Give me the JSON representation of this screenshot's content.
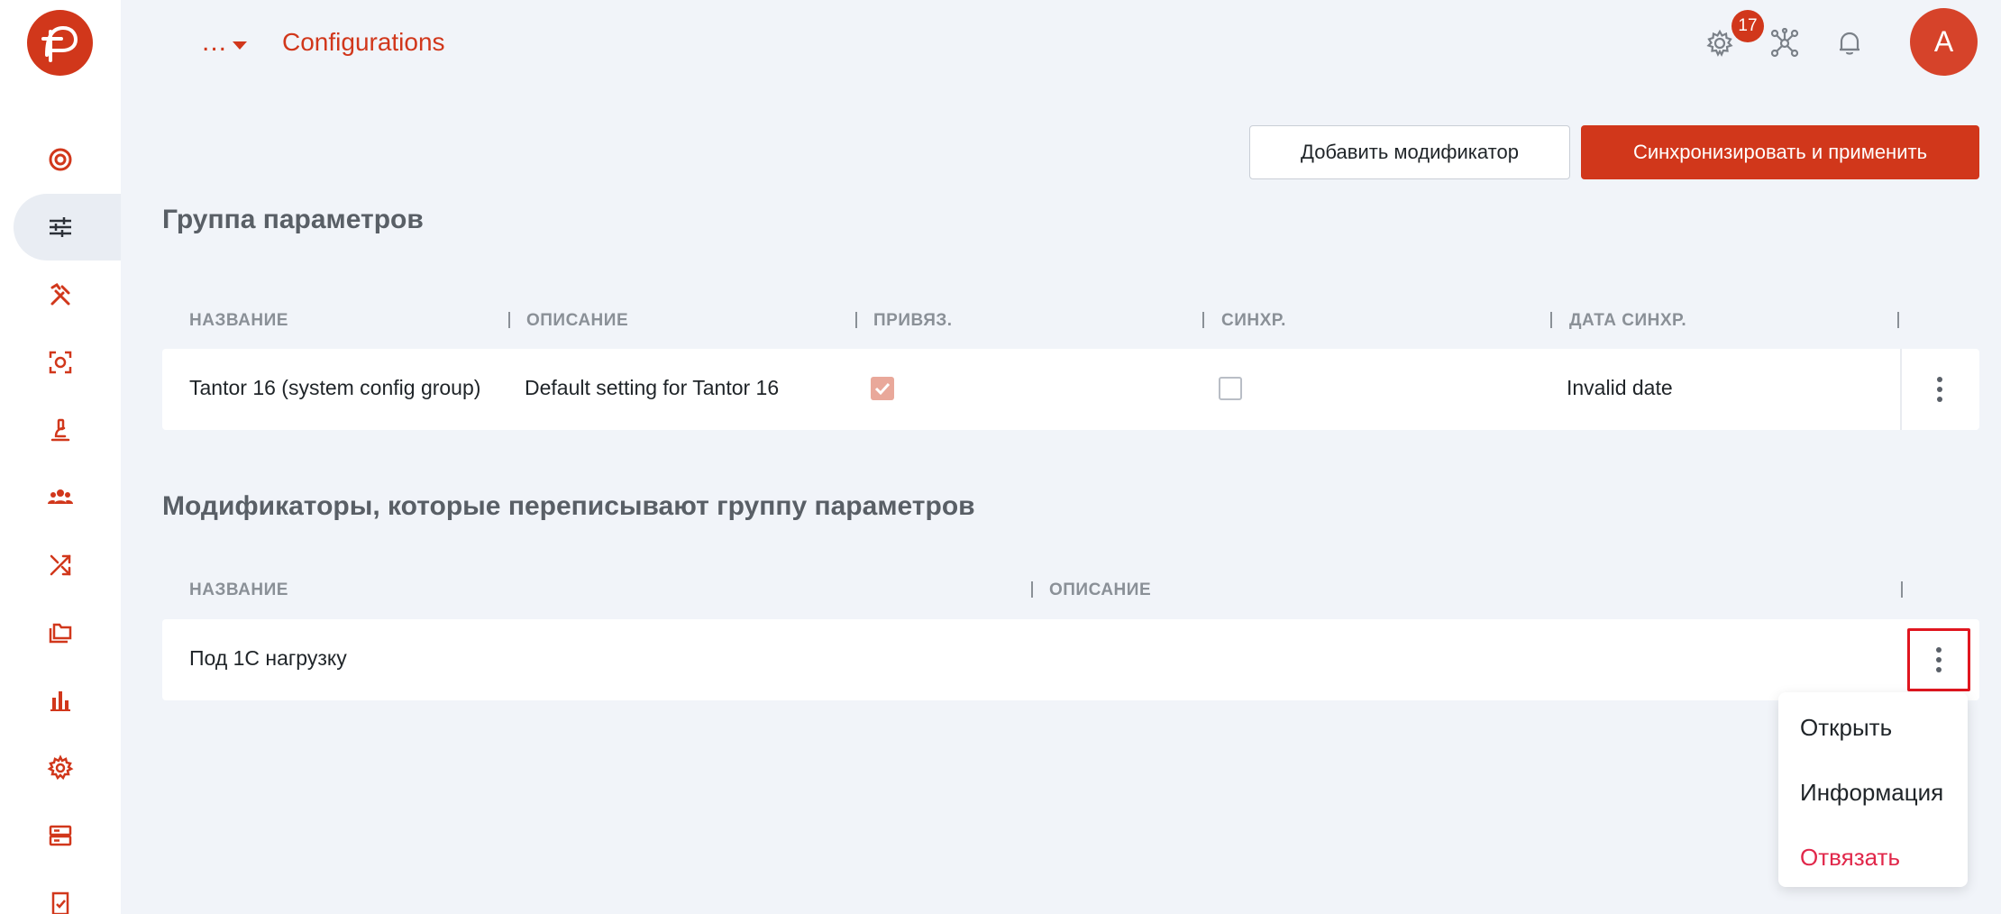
{
  "sidebar": {
    "items": [
      {
        "icon": "target-icon"
      },
      {
        "icon": "sliders-icon",
        "active": true
      },
      {
        "icon": "tools-icon"
      },
      {
        "icon": "scan-icon"
      },
      {
        "icon": "microscope-icon"
      },
      {
        "icon": "users-icon"
      },
      {
        "icon": "shuffle-icon"
      },
      {
        "icon": "folders-icon"
      },
      {
        "icon": "bar-chart-icon"
      },
      {
        "icon": "gear-icon"
      },
      {
        "icon": "server-icon"
      },
      {
        "icon": "document-check-icon"
      }
    ]
  },
  "header": {
    "breadcrumb_more": "...",
    "title": "Configurations",
    "notifications_count": "17",
    "avatar_letter": "A"
  },
  "toolbar": {
    "add_modifier_label": "Добавить модификатор",
    "sync_apply_label": "Синхронизировать и применить"
  },
  "param_group": {
    "title": "Группа параметров",
    "columns": [
      "НАЗВАНИЕ",
      "ОПИСАНИЕ",
      "ПРИВЯЗ.",
      "СИНХР.",
      "ДАТА СИНХР."
    ],
    "row": {
      "name": "Tantor 16 (system config group)",
      "description": "Default setting for Tantor 16",
      "bound": true,
      "synced": false,
      "sync_date": "Invalid date"
    }
  },
  "modifiers": {
    "title": "Модификаторы, которые переписывают группу параметров",
    "columns": [
      "НАЗВАНИЕ",
      "ОПИСАНИЕ"
    ],
    "row": {
      "name": "Под 1С нагрузку",
      "description": ""
    }
  },
  "context_menu": {
    "items": [
      "Открыть",
      "Информация",
      "Отвязать"
    ]
  },
  "colors": {
    "accent": "#d1371b",
    "danger": "#e1274a",
    "background": "#f1f4f9"
  }
}
